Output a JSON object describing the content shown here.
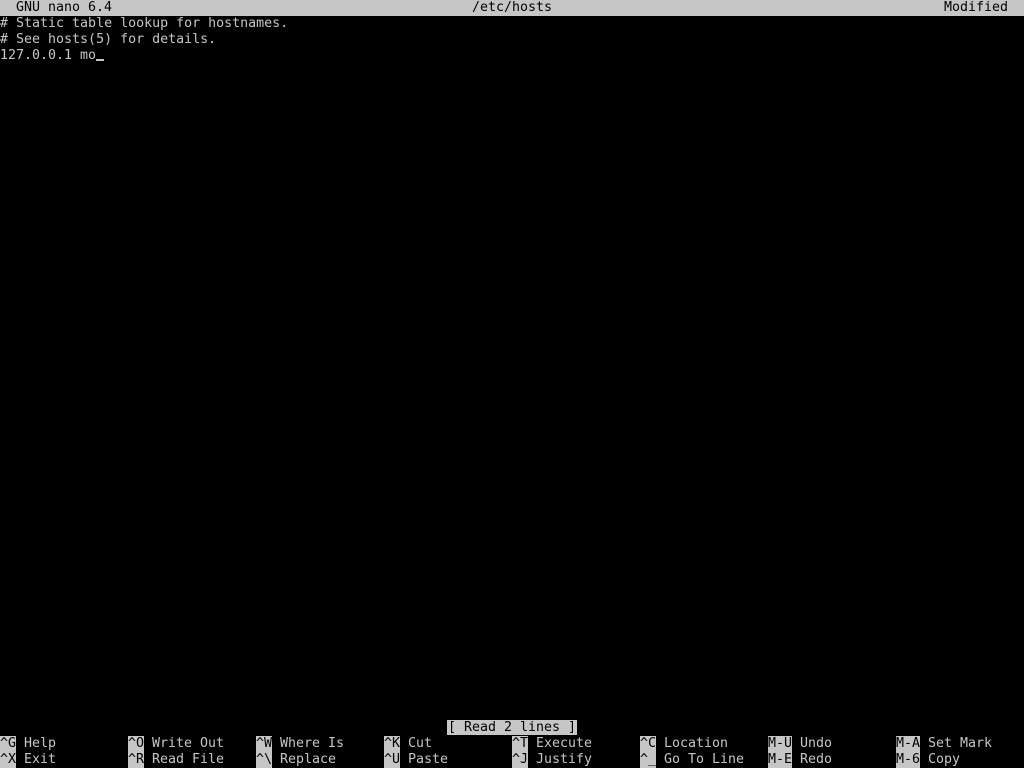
{
  "title_bar": {
    "app": "GNU nano 6.4",
    "file": "/etc/hosts",
    "state": "Modified"
  },
  "editor": {
    "lines": [
      "# Static table lookup for hostnames.",
      "# See hosts(5) for details.",
      "127.0.0.1 mo"
    ]
  },
  "status_message": "[ Read 2 lines ]",
  "shortcuts": [
    {
      "key": "^G",
      "label": "Help"
    },
    {
      "key": "^X",
      "label": "Exit"
    },
    {
      "key": "^O",
      "label": "Write Out"
    },
    {
      "key": "^R",
      "label": "Read File"
    },
    {
      "key": "^W",
      "label": "Where Is"
    },
    {
      "key": "^\\",
      "label": "Replace"
    },
    {
      "key": "^K",
      "label": "Cut"
    },
    {
      "key": "^U",
      "label": "Paste"
    },
    {
      "key": "^T",
      "label": "Execute"
    },
    {
      "key": "^J",
      "label": "Justify"
    },
    {
      "key": "^C",
      "label": "Location"
    },
    {
      "key": "^_",
      "label": "Go To Line"
    },
    {
      "key": "M-U",
      "label": "Undo"
    },
    {
      "key": "M-E",
      "label": "Redo"
    },
    {
      "key": "M-A",
      "label": "Set Mark"
    },
    {
      "key": "M-6",
      "label": "Copy"
    }
  ],
  "colors": {
    "background": "#000000",
    "foreground": "#c6c6c6",
    "inverse_bg": "#c6c6c6",
    "inverse_fg": "#000000"
  }
}
